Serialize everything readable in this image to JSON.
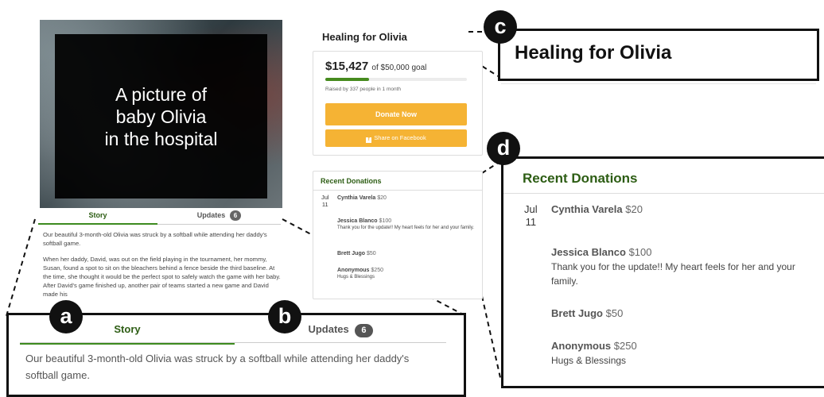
{
  "photo": {
    "caption": "A picture of\nbaby Olivia\nin the hospital"
  },
  "tabs": {
    "story": "Story",
    "updates": "Updates",
    "updates_count": "6"
  },
  "story": {
    "p1": "Our beautiful 3-month-old Olivia was struck by a softball while attending her daddy's softball game.",
    "p2": "When her daddy, David, was out on the field playing in the tournament, her mommy, Susan, found a spot to sit on the bleachers behind a fence beside the third baseline. At the time, she thought it would be the perfect spot to safely watch the game with her baby. After David's game finished up, another pair of teams started a new game and David made his"
  },
  "campaign": {
    "title": "Healing for Olivia",
    "raised": "$15,427",
    "goal_text": "of $50,000 goal",
    "progress_fraction": 0.31,
    "raised_by": "Raised by 337 people in 1 month",
    "donate_label": "Donate Now",
    "share_label": "Share on Facebook",
    "accent_color": "#f5b334",
    "progress_color": "#468b1e"
  },
  "donations": {
    "title": "Recent Donations",
    "date_month": "Jul",
    "date_day": "11",
    "items": [
      {
        "name": "Cynthia Varela",
        "amount": "$20",
        "message": ""
      },
      {
        "name": "Jessica Blanco",
        "amount": "$100",
        "message": "Thank you for the update!! My heart feels for her and your family."
      },
      {
        "name": "Brett Jugo",
        "amount": "$50",
        "message": ""
      },
      {
        "name": "Anonymous",
        "amount": "$250",
        "message": "Hugs & Blessings"
      }
    ]
  },
  "annotations": {
    "a": "a",
    "b": "b",
    "c": "c",
    "d": "d"
  }
}
